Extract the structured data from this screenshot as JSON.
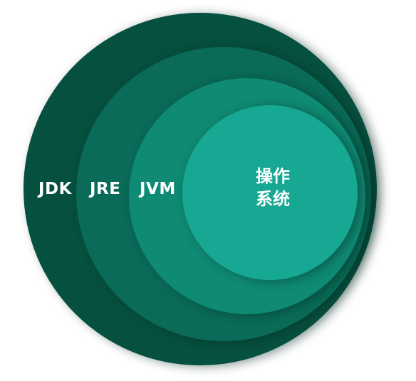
{
  "diagram": {
    "layers": [
      {
        "id": "jdk",
        "label": "JDK",
        "color": "#06503f"
      },
      {
        "id": "jre",
        "label": "JRE",
        "color": "#0a6b58"
      },
      {
        "id": "jvm",
        "label": "JVM",
        "color": "#0f8a73"
      },
      {
        "id": "os",
        "label_lines": [
          "操作",
          "系统"
        ],
        "color": "#17a894"
      }
    ]
  }
}
